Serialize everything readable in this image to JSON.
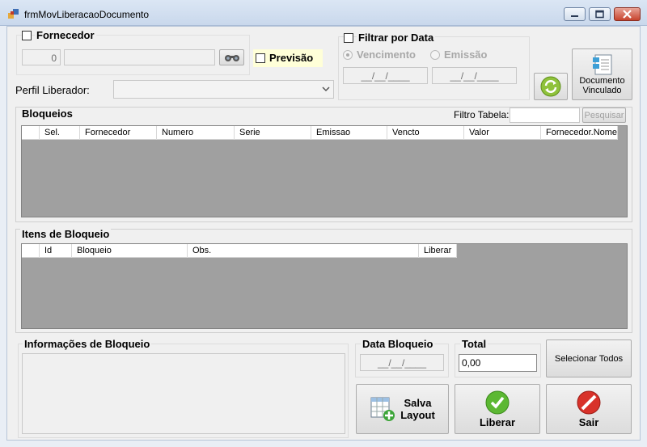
{
  "window": {
    "title": "frmMovLiberacaoDocumento"
  },
  "fornecedor": {
    "label": "Fornecedor",
    "code": "0",
    "name": ""
  },
  "previsao": {
    "label": "Previsão"
  },
  "filtro_data": {
    "label": "Filtrar por Data",
    "radio_vencimento": "Vencimento",
    "radio_emissao": "Emissão",
    "date_from": "__/__/____",
    "date_to": "__/__/____"
  },
  "perfil": {
    "label": "Perfil Liberador:",
    "value": ""
  },
  "documento_button": {
    "line1": "Documento",
    "line2": "Vinculado"
  },
  "bloqueios": {
    "title": "Bloqueios",
    "filter_label": "Filtro Tabela:",
    "filter_value": "",
    "search_label": "Pesquisar",
    "columns": [
      "Sel.",
      "Fornecedor",
      "Numero",
      "Serie",
      "Emissao",
      "Vencto",
      "Valor",
      "Fornecedor.Nome"
    ]
  },
  "itens": {
    "title": "Itens de Bloqueio",
    "columns": [
      "Id",
      "Bloqueio",
      "Obs.",
      "Liberar"
    ]
  },
  "informacoes": {
    "title": "Informações de Bloqueio",
    "text": ""
  },
  "data_bloqueio": {
    "title": "Data Bloqueio",
    "value": "__/__/____"
  },
  "total": {
    "title": "Total",
    "value": "0,00"
  },
  "buttons": {
    "selecionar_todos": "Selecionar Todos",
    "salva_line1": "Salva",
    "salva_line2": "Layout",
    "liberar": "Liberar",
    "sair": "Sair"
  }
}
